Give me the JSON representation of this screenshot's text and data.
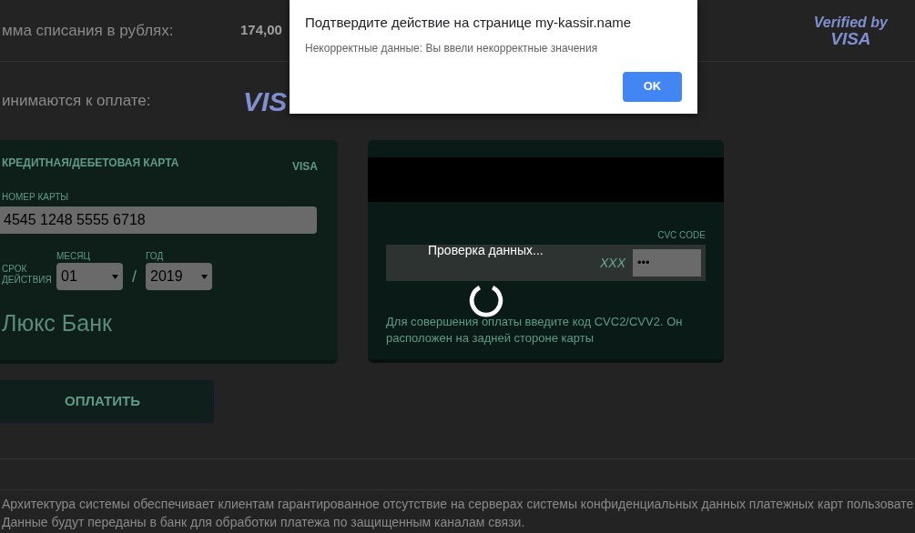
{
  "amount_row": {
    "label": "мма списания в рублях:",
    "value": "174,00"
  },
  "verified_logo": {
    "line_1": "Verified by",
    "line_2": "VISA"
  },
  "accepted_row": {
    "label": "инимаются к оплате:",
    "logo": "VIS"
  },
  "card_front": {
    "title": "КРЕДИТНАЯ/ДЕБЕТОВАЯ КАРТА",
    "brand": "VISA",
    "number_label": "НОМЕР КАРТЫ",
    "number": "4545 1248 5555 6718",
    "expiry_label": "СРОК ДЕЙСТВИЯ",
    "month_label": "МЕСЯЦ",
    "month": "01",
    "separator": "/",
    "year_label": "ГОД",
    "year": "2019",
    "bank": "Люкс Банк"
  },
  "pay_button": "ОПЛАТИТЬ",
  "card_back": {
    "cvc_label": "CVC CODE",
    "cvc_placeholder": "XXX",
    "cvc_value": "•••",
    "hint": "Для совершения оплаты введите код CVC2/CVV2. Он расположен на задней стороне карты"
  },
  "loader": {
    "text": "Проверка данных..."
  },
  "footer": [
    "Архитектура системы обеспечивает клиентам гарантированное отсутствие на серверах системы конфиденциальных данных платежных карт пользовате",
    "Данные будут переданы в банк для обработки платежа по защищенным каналам связи."
  ],
  "dialog": {
    "title": "Подтвердите действие на странице my-kassir.name",
    "message": "Некорректные данные: Вы ввели некорректные значения",
    "buttons": [
      "OK"
    ]
  }
}
